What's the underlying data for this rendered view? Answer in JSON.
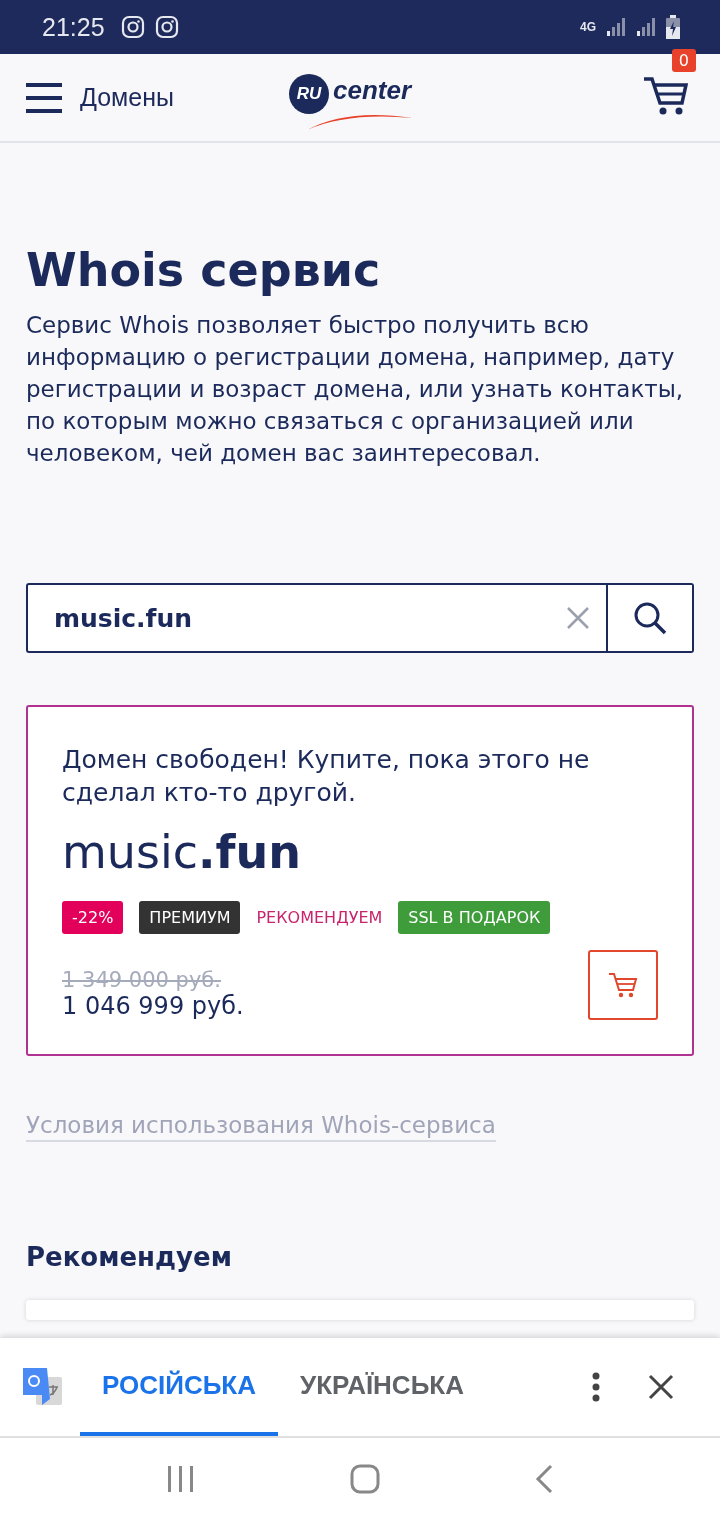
{
  "status_bar": {
    "time": "21:25",
    "network": "4G"
  },
  "header": {
    "menu_label": "Домены",
    "logo": {
      "badge": "RU",
      "word": "center"
    },
    "cart_count": "0"
  },
  "title": "Whois сервис",
  "description": "Сервис Whois позволяет быстро получить всю информацию о регистрации домена, например, дату регистрации и возраст домена, или узнать контакты, по которым можно связаться с организацией или человеком, чей домен вас заинтересовал.",
  "search": {
    "value": "music.fun"
  },
  "result": {
    "message": "Домен свободен! Купите, пока этого не сделал кто-то другой.",
    "domain": "music**.fun**",
    "tags": [
      {
        "label": "-22%",
        "kind": "filled",
        "color": "#e2005a"
      },
      {
        "label": "ПРЕМИУМ",
        "kind": "filled",
        "color": "#333333"
      },
      {
        "label": "РЕКОМЕНДУЕМ",
        "kind": "plain",
        "color": "#c8246e"
      },
      {
        "label": "SSL В ПОДАРОК",
        "kind": "filled",
        "color": "#3e9c3a"
      }
    ],
    "old_price": "1 349 000 руб.",
    "price": "1 046 999 руб."
  },
  "terms_link": "Условия использования Whois-сервиса",
  "recommend_heading": "Рекомендуем",
  "translate_bar": {
    "tabs": [
      {
        "label": "РОСІЙСЬКА",
        "selected": true
      },
      {
        "label": "УКРАЇНСЬКА",
        "selected": false
      }
    ]
  }
}
